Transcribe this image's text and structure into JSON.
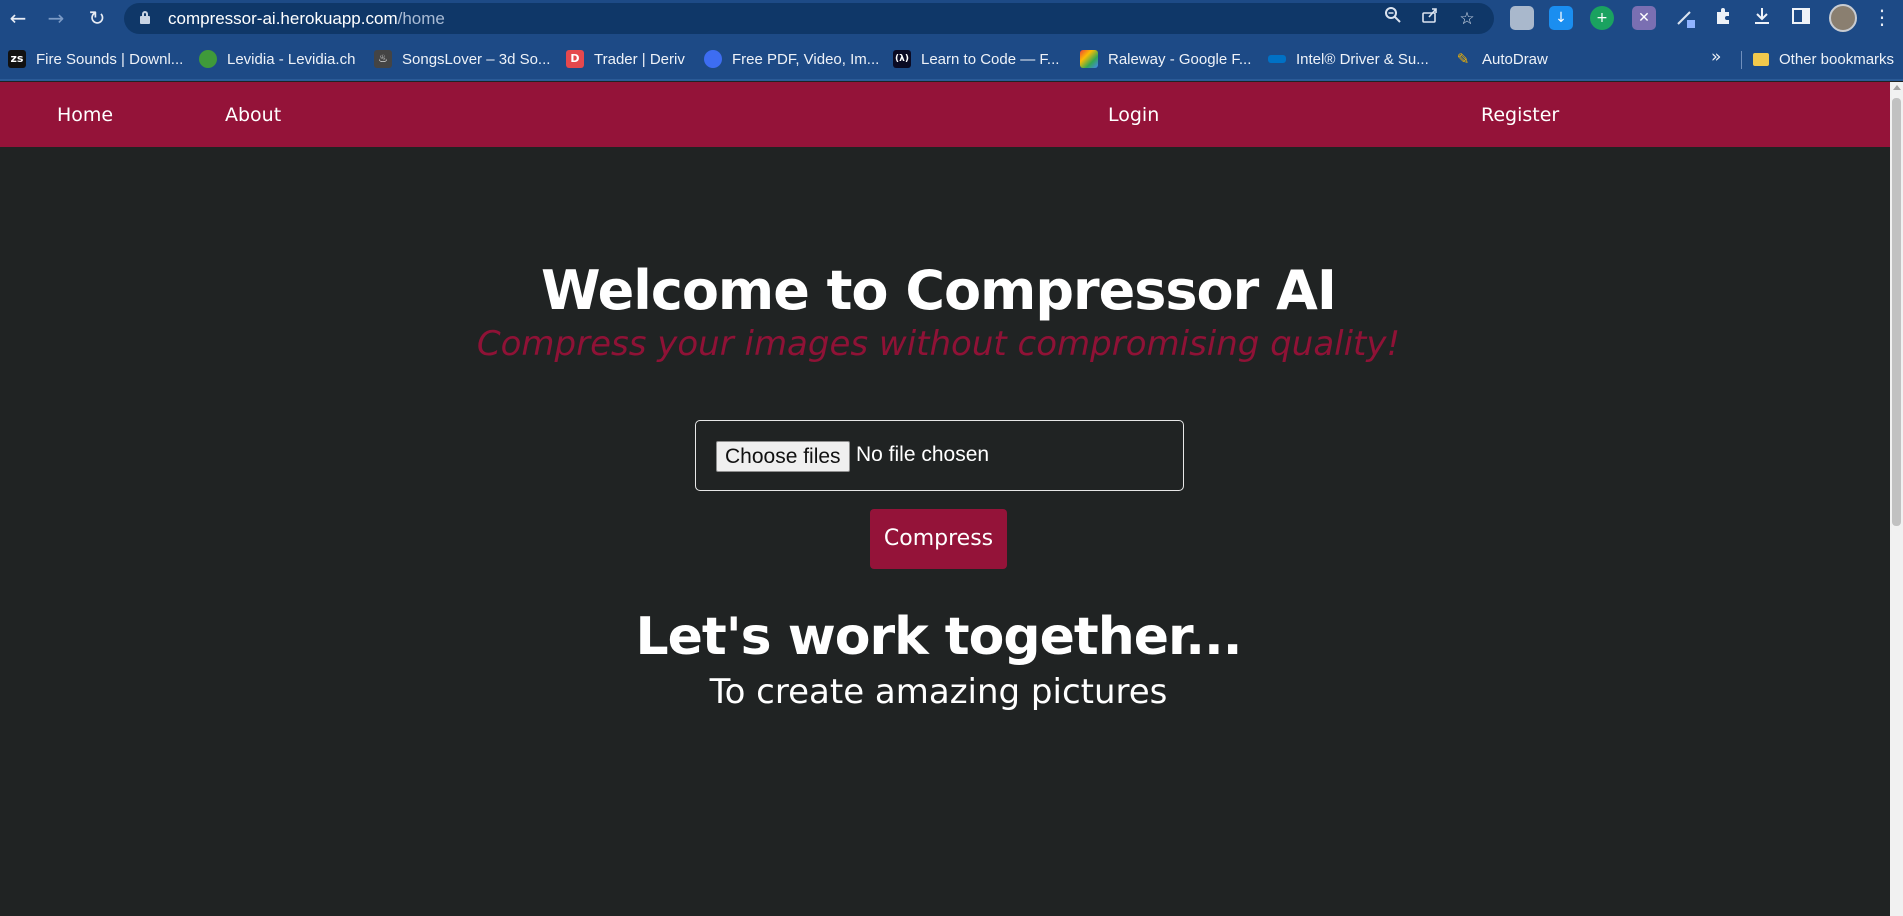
{
  "browser": {
    "url_host": "compressor-ai.herokuapp.com",
    "url_path": "/home",
    "icons": [
      "back-icon",
      "forward-icon",
      "reload-icon",
      "lock-icon",
      "zoom-icon",
      "share-icon",
      "star-icon",
      "extensions-icon",
      "download-icon",
      "sidepanel-icon",
      "menu-icon"
    ]
  },
  "bookmarks": {
    "items": [
      {
        "label": "Fire Sounds | Downl...",
        "icon": "zs",
        "color": "#111111"
      },
      {
        "label": "Levidia - Levidia.ch",
        "icon": "",
        "color": "#3f9a3a"
      },
      {
        "label": "SongsLover – 3d So...",
        "icon": "",
        "color": "#444444"
      },
      {
        "label": "Trader | Deriv",
        "icon": "D",
        "color": "#e5484d"
      },
      {
        "label": "Free PDF, Video, Im...",
        "icon": "",
        "color": "#3d6df2"
      },
      {
        "label": "Learn to Code — F...",
        "icon": "(λ)",
        "color": "#0a0a23"
      },
      {
        "label": "Raleway - Google F...",
        "icon": "",
        "color": "#f4b400"
      },
      {
        "label": "Intel® Driver & Su...",
        "icon": "",
        "color": "#0071c5"
      },
      {
        "label": "AutoDraw",
        "icon": "",
        "color": "#1d4a86"
      }
    ],
    "more": "»",
    "other": "Other bookmarks"
  },
  "site": {
    "nav": {
      "home": "Home",
      "about": "About",
      "login": "Login",
      "register": "Register"
    },
    "hero": {
      "title": "Welcome to Compressor AI",
      "tagline": "Compress your images without compromising quality!"
    },
    "upload": {
      "button_label": "Choose files",
      "status": "No file chosen"
    },
    "compress_label": "Compress",
    "together": {
      "title": "Let's work together...",
      "subtitle": "To create amazing pictures"
    },
    "colors": {
      "accent": "#941339",
      "background": "#202323",
      "tagline": "#8f1236"
    }
  }
}
